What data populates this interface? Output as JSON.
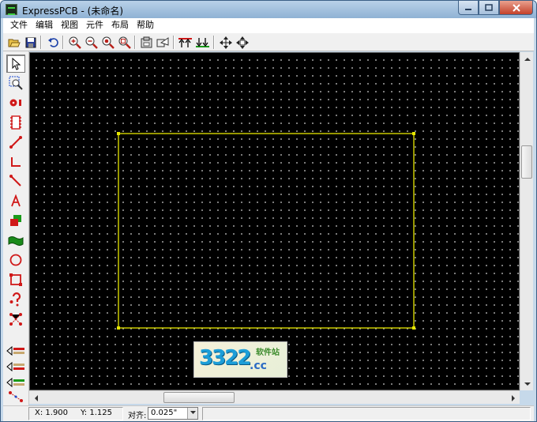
{
  "window": {
    "title": "ExpressPCB - (未命名)"
  },
  "menu": [
    "文件",
    "编辑",
    "视图",
    "元件",
    "布局",
    "帮助"
  ],
  "toolbar": {
    "buttons": [
      "open-icon",
      "save-icon",
      "undo-icon",
      "zoom-in-icon",
      "zoom-out-icon",
      "zoom-full-icon",
      "zoom-area-icon",
      "properties-icon",
      "send-order-icon",
      "layer-top-icon",
      "layer-bottom-icon",
      "move-icon",
      "pan-icon"
    ]
  },
  "left_tools": [
    "pointer-icon",
    "zoom-select-icon",
    "pad-icon",
    "component-icon",
    "trace-icon",
    "trace-corner-icon",
    "trace-diagonal-icon",
    "text-icon",
    "filled-area-icon",
    "ground-plane-icon",
    "circle-icon",
    "rectangle-icon",
    "question-icon",
    "netlist-icon",
    "layer-top-copper-icon",
    "layer-bottom-copper-icon",
    "layer-silkscreen-icon",
    "layer-all-icon"
  ],
  "status": {
    "x": "X: 1.900",
    "y": "Y: 1.125",
    "snap_label": "对齐:",
    "snap_value": "0.025\""
  },
  "watermark": {
    "number": "3322",
    "site_cn": "软件站",
    "suffix": ".cc"
  },
  "colors": {
    "canvas": "#000000",
    "board_outline": "#e6e600",
    "grid_dot": "#9a9a9a"
  }
}
